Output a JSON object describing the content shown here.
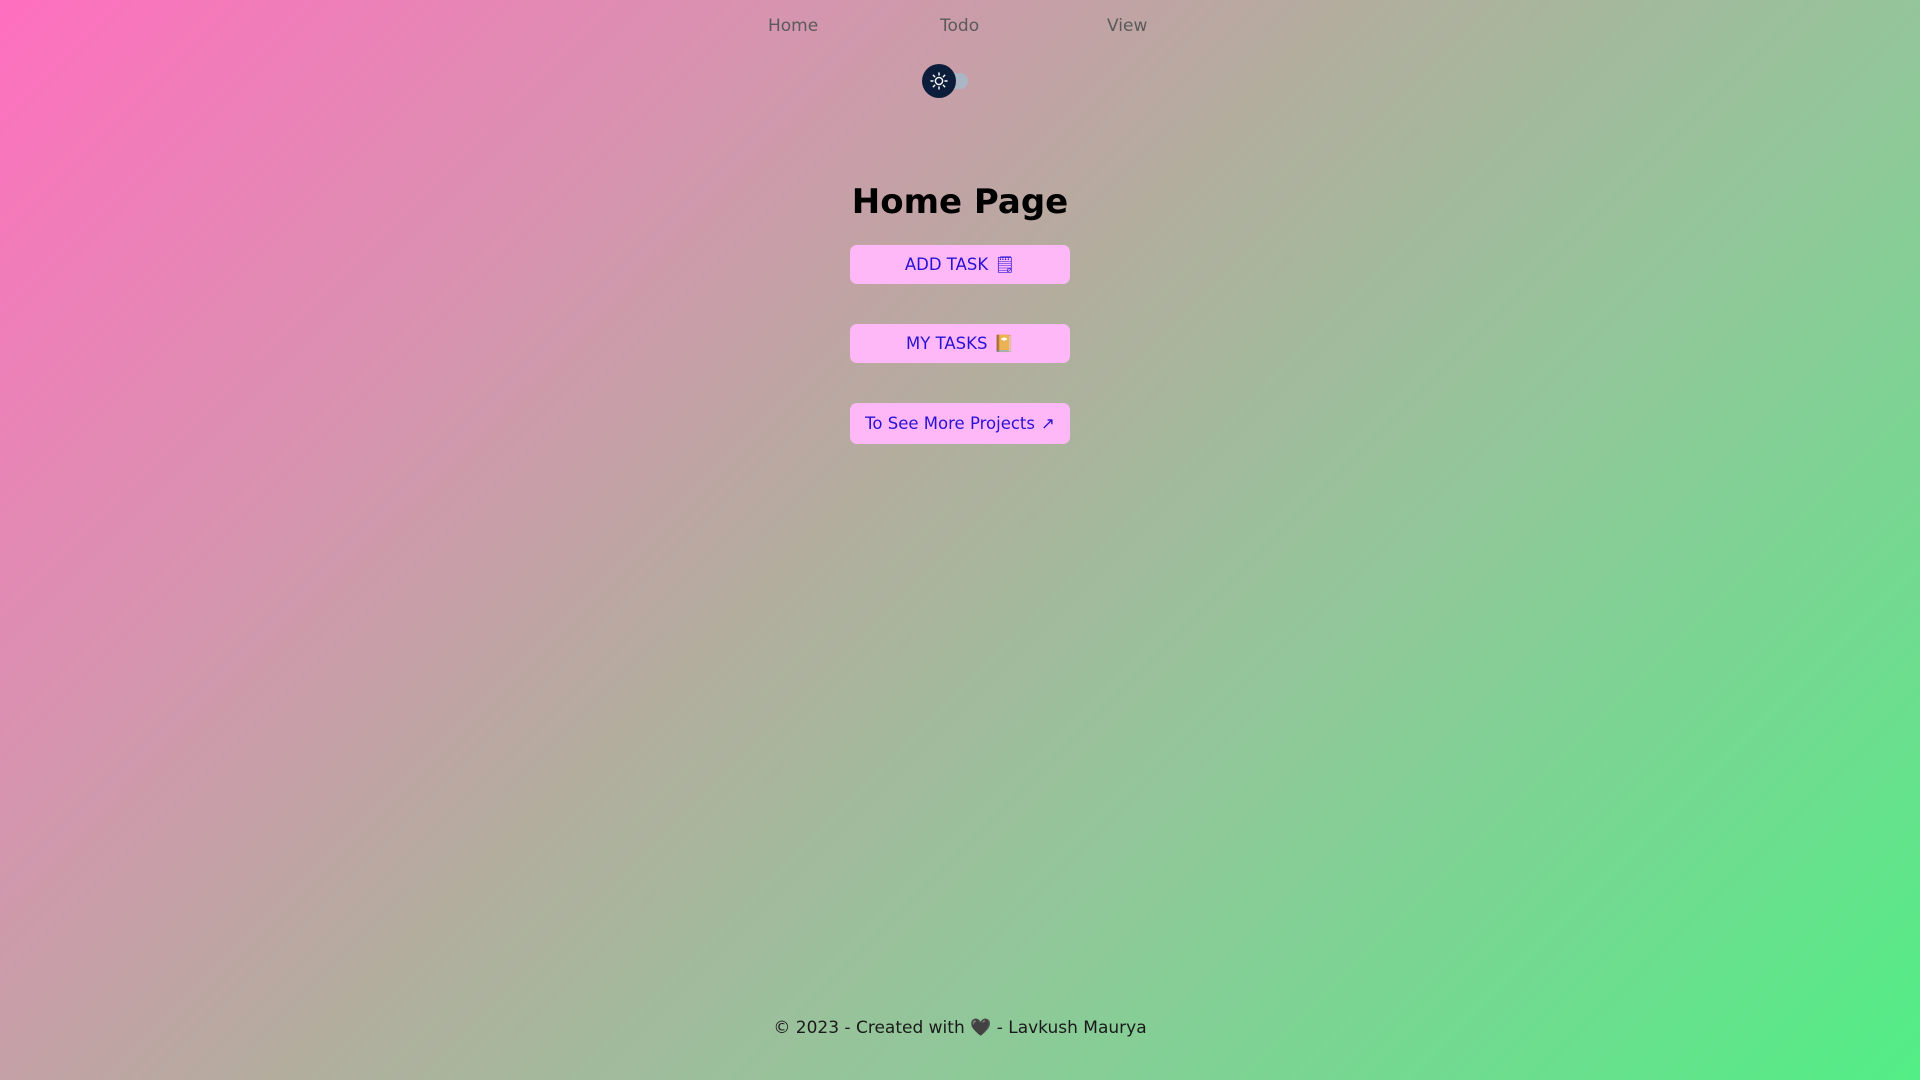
{
  "nav": {
    "items": [
      {
        "label": "Home"
      },
      {
        "label": "Todo"
      },
      {
        "label": "View"
      }
    ]
  },
  "theme_toggle": {
    "icon": "sun-icon",
    "state": "light",
    "colors": {
      "knob": "#0b1d3a",
      "track": "#aab6c3"
    }
  },
  "main": {
    "title": "Home Page",
    "buttons": [
      {
        "label": "ADD TASK",
        "emoji": "🗒"
      },
      {
        "label": "MY TASKS",
        "emoji": "📔"
      },
      {
        "label": "To See More Projects",
        "emoji": "↗"
      }
    ]
  },
  "footer": {
    "text": "© 2023 - Created with 🖤 - Lavkush Maurya"
  },
  "colors": {
    "button_bg": "#ffb8f7",
    "button_text": "#2a10d6",
    "gradient_start": "#ff6fbf",
    "gradient_end": "#52ee86"
  }
}
